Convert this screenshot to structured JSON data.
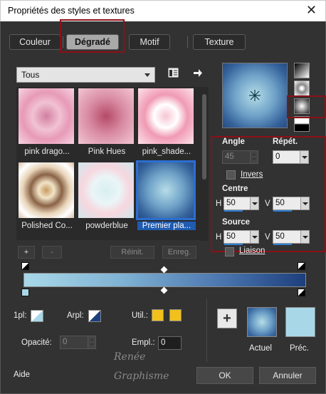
{
  "window": {
    "title": "Propriétés des styles et textures",
    "close": "✕"
  },
  "tabs": [
    {
      "label": "Couleur"
    },
    {
      "label": "Dégradé",
      "active": true
    },
    {
      "label": "Motif"
    },
    {
      "label": "Texture"
    }
  ],
  "library": {
    "filter_value": "Tous",
    "items": [
      {
        "label": "pink drago..."
      },
      {
        "label": "Pink Hues"
      },
      {
        "label": "pink_shade..."
      },
      {
        "label": "Polished Co..."
      },
      {
        "label": "powderblue"
      },
      {
        "label": "Premier pla...",
        "selected": true
      }
    ],
    "add": "+",
    "remove": "-",
    "reset": "Réinit.",
    "save": "Enreg."
  },
  "settings": {
    "angle_label": "Angle",
    "angle_value": "45",
    "repeat_label": "Répét.",
    "repeat_value": "0",
    "invert_label": "Invers",
    "centre_label": "Centre",
    "centre_h": "50",
    "centre_v": "50",
    "source_label": "Source",
    "source_h": "50",
    "source_v": "50",
    "h": "H",
    "v": "V",
    "link_label": "Liaison"
  },
  "stops": {
    "location_label": "1pl:",
    "opacity_point_label": "Arpl:",
    "use_label": "Util.:",
    "opacity_label": "Opacité:",
    "opacity_value": "0",
    "position_label": "Empl.:",
    "position_value": "0"
  },
  "swatches": {
    "add": "+",
    "current_label": "Actuel",
    "previous_label": "Préc."
  },
  "footer": {
    "help": "Aide",
    "ok": "OK",
    "cancel": "Annuler",
    "watermark_line1": "Renée",
    "watermark_line2": "Graphisme"
  },
  "colors": {
    "background": "#323232",
    "highlight_red": "#8c1017",
    "selection_blue": "#2b6fd0",
    "gradient_light": "#a8d8e8",
    "gradient_dark": "#1d3f7d",
    "swatch_yellow": "#f2c01a"
  }
}
